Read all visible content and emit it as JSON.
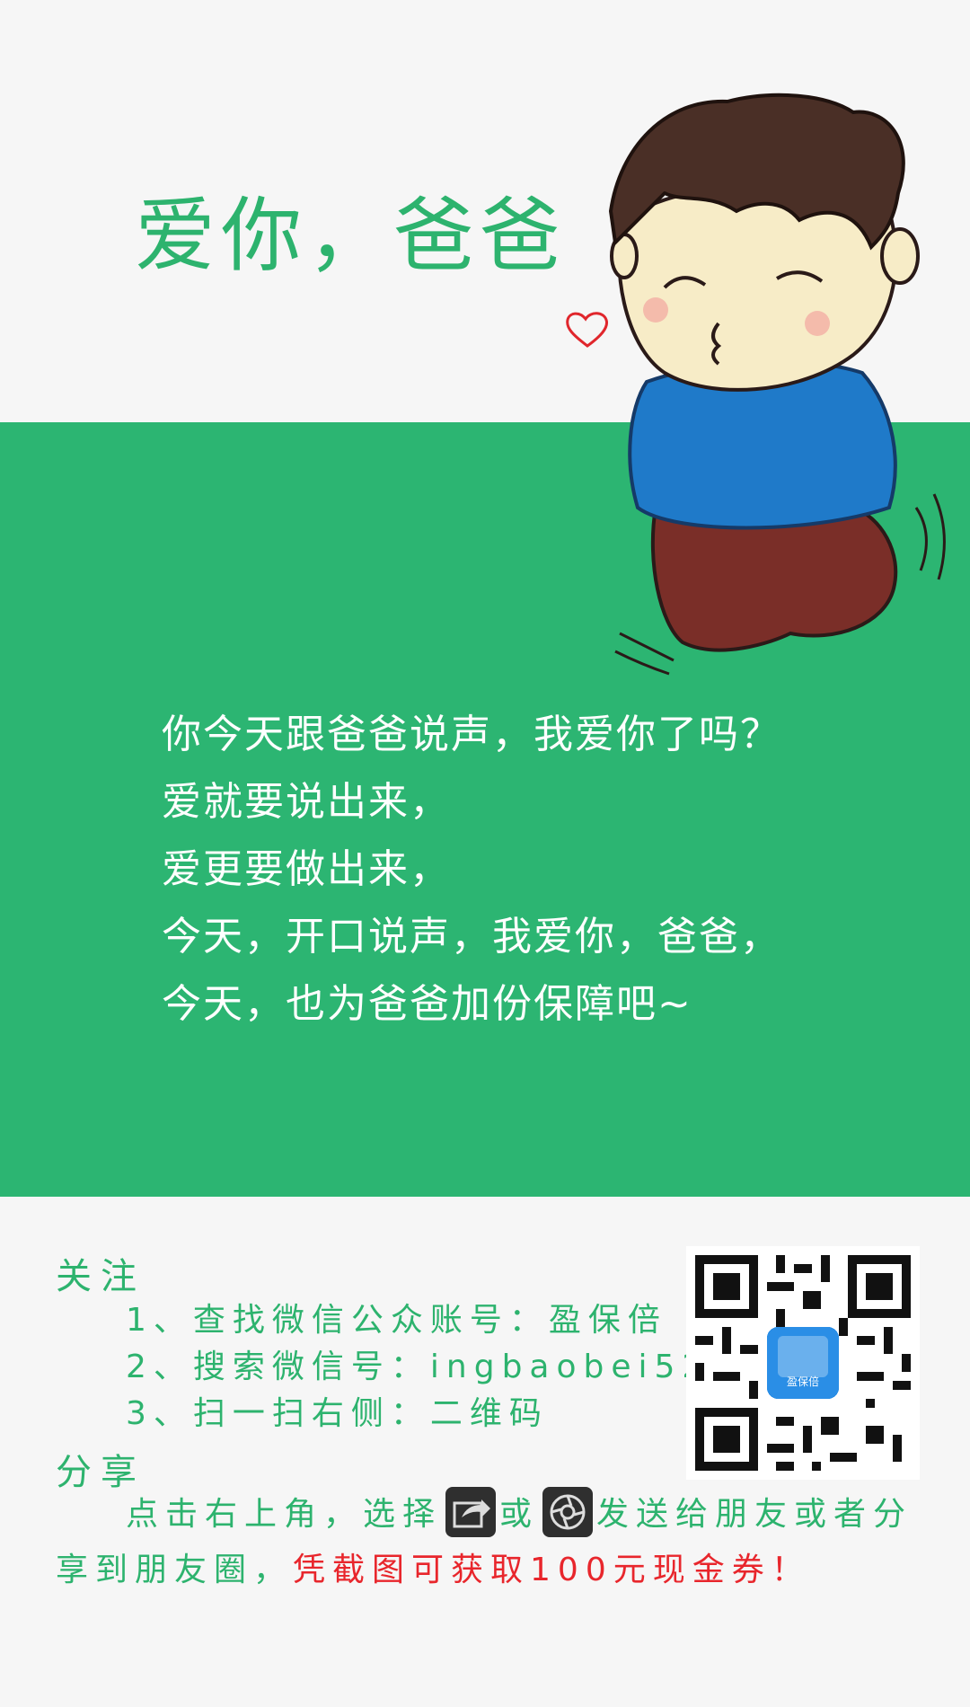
{
  "header": {
    "title": "爱你，爸爸"
  },
  "message": {
    "lines": [
      "你今天跟爸爸说声，我爱你了吗？",
      "爱就要说出来，",
      "爱更要做出来，",
      "今天，开口说声，我爱你，爸爸，",
      "今天，也为爸爸加份保障吧~"
    ]
  },
  "follow": {
    "heading": "关注",
    "steps": [
      "1、查找微信公众账号：盈保倍",
      "2、搜索微信号：ingbaobei520",
      "3、扫一扫右侧：二维码"
    ]
  },
  "share": {
    "heading": "分享",
    "text_part1": "点击右上角，选择",
    "text_or": "或",
    "text_part2": "发送给朋友或者分",
    "text_part3": "享到朋友圈，",
    "highlight": "凭截图可获取100元现金券！"
  },
  "qr": {
    "logo_text": "盈保倍"
  },
  "colors": {
    "green": "#2cb572",
    "text_green": "#2db36e",
    "red": "#e8262c"
  },
  "icons": [
    "heart-icon",
    "share-icon",
    "moments-icon",
    "qr-code"
  ]
}
